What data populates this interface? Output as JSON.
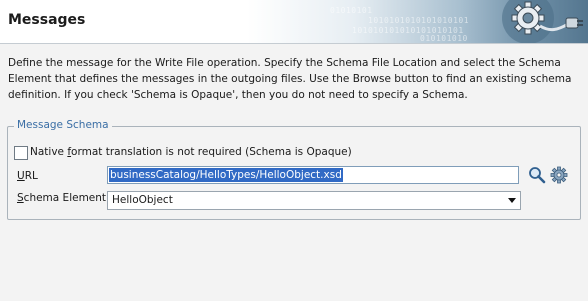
{
  "header": {
    "title": "Messages",
    "binary_rows": [
      "01010101",
      "1010101010101010101",
      "101010101010101010101",
      "010101010"
    ]
  },
  "intro": {
    "text": "Define the message for the Write File operation.  Specify the Schema File Location and select the Schema Element that defines the messages in the outgoing files. Use the Browse button to find an existing schema definition. If you check 'Schema is Opaque', then you do not need to specify a Schema."
  },
  "message_schema": {
    "legend": "Message Schema",
    "opaque_checkbox": {
      "label_prefix": "Native ",
      "label_mnemonic": "f",
      "label_suffix": "ormat translation is not required (Schema is Opaque)",
      "checked": false
    },
    "url": {
      "label_mnemonic": "U",
      "label_suffix": "RL",
      "value": "businessCatalog/HelloTypes/HelloObject.xsd"
    },
    "schema_element": {
      "label_mnemonic": "S",
      "label_suffix": "chema Element",
      "selected": "HelloObject"
    }
  },
  "icons": {
    "search": "magnifier-icon",
    "settings": "gear-icon",
    "header_logo": "gear-plug-logo"
  },
  "colors": {
    "legend": "#3a6ea5",
    "selection": "#316ac5",
    "header_accent": "#54768f"
  }
}
